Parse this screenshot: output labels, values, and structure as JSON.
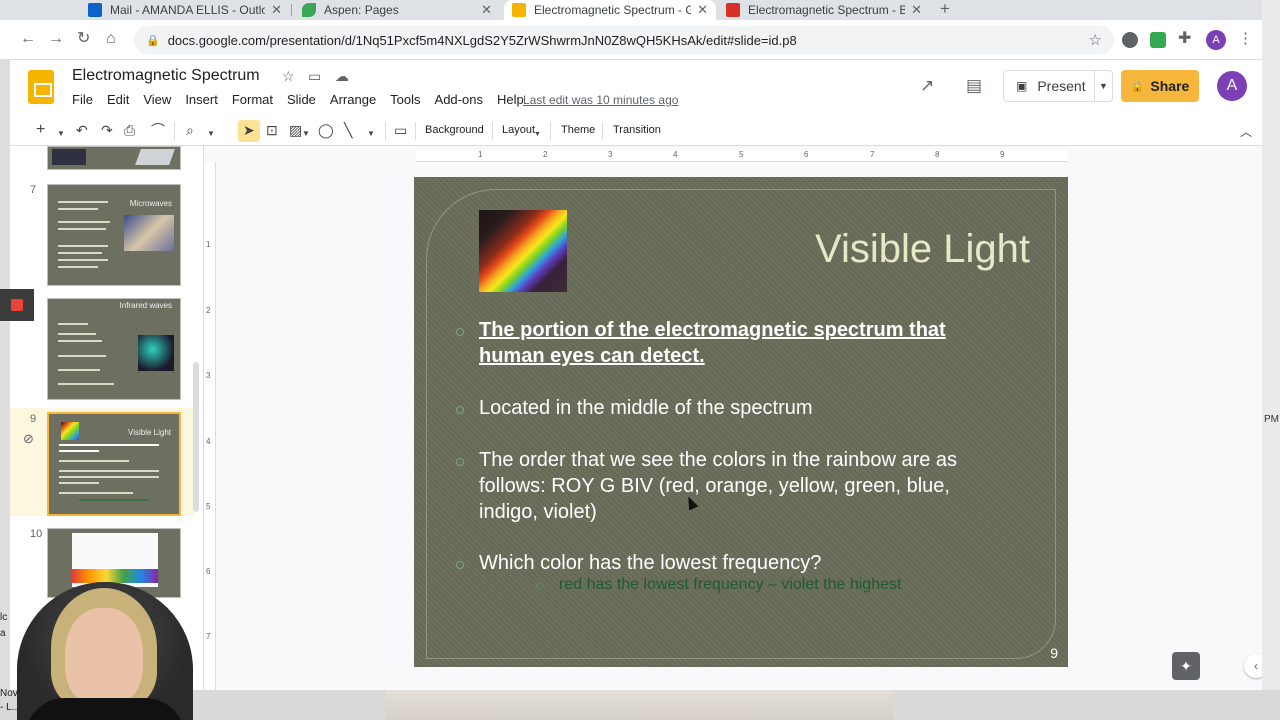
{
  "browser": {
    "tabs": [
      {
        "title": "Mail - AMANDA ELLIS - Outlook",
        "icon": "outlook-icon",
        "color": "#0a64c8"
      },
      {
        "title": "Aspen: Pages",
        "icon": "aspen-leaf-icon",
        "color": "#3aa757"
      },
      {
        "title": "Electromagnetic Spectrum - Google Slides",
        "icon": "slides-icon",
        "color": "#f4b400",
        "active": true
      },
      {
        "title": "Electromagnetic Spectrum - BrainPOP",
        "icon": "brainpop-icon",
        "color": "#d93025"
      }
    ],
    "url": "docs.google.com/presentation/d/1Nq51Pxcf5m4NXLgdS2Y5ZrWShwrmJnN0Z8wQH5KHsAk/edit#slide=id.p8",
    "profile_initial": "A"
  },
  "docs": {
    "title": "Electromagnetic Spectrum",
    "menu": [
      "File",
      "Edit",
      "View",
      "Insert",
      "Format",
      "Slide",
      "Arrange",
      "Tools",
      "Add-ons",
      "Help"
    ],
    "last_edit": "Last edit was 10 minutes ago",
    "present_label": "Present",
    "share_label": "Share",
    "avatar_initial": "A"
  },
  "toolbar": {
    "background": "Background",
    "layout": "Layout",
    "theme": "Theme",
    "transition": "Transition"
  },
  "filmstrip": {
    "slides": [
      {
        "num": "7",
        "title": "Microwaves"
      },
      {
        "num": "",
        "title": "Infrared waves"
      },
      {
        "num": "9",
        "title": "Visible Light"
      },
      {
        "num": "10",
        "title": ""
      }
    ]
  },
  "ruler": {
    "h": [
      "1",
      "2",
      "3",
      "4",
      "5",
      "6",
      "7",
      "8",
      "9"
    ],
    "v": [
      "1",
      "2",
      "3",
      "4",
      "5",
      "6",
      "7"
    ]
  },
  "slide": {
    "title": "Visible Light",
    "bullets": [
      {
        "lines": [
          "The portion of the electromagnetic spectrum that",
          "human eyes can detect."
        ]
      },
      {
        "lines": [
          "Located in the middle of the spectrum"
        ]
      },
      {
        "lines": [
          "The order that we see the colors in the rainbow are as",
          "follows: ROY G BIV (red, orange, yellow, green, blue,",
          "indigo, violet)"
        ]
      },
      {
        "lines": [
          "Which color has the lowest frequency?"
        ]
      }
    ],
    "sub_bullet": "red has the lowest frequency – violet the highest",
    "number": "9"
  },
  "edge": {
    "right_text": "PM",
    "left_texts": [
      "lc",
      "a",
      "Novel",
      "- L...ing"
    ]
  }
}
